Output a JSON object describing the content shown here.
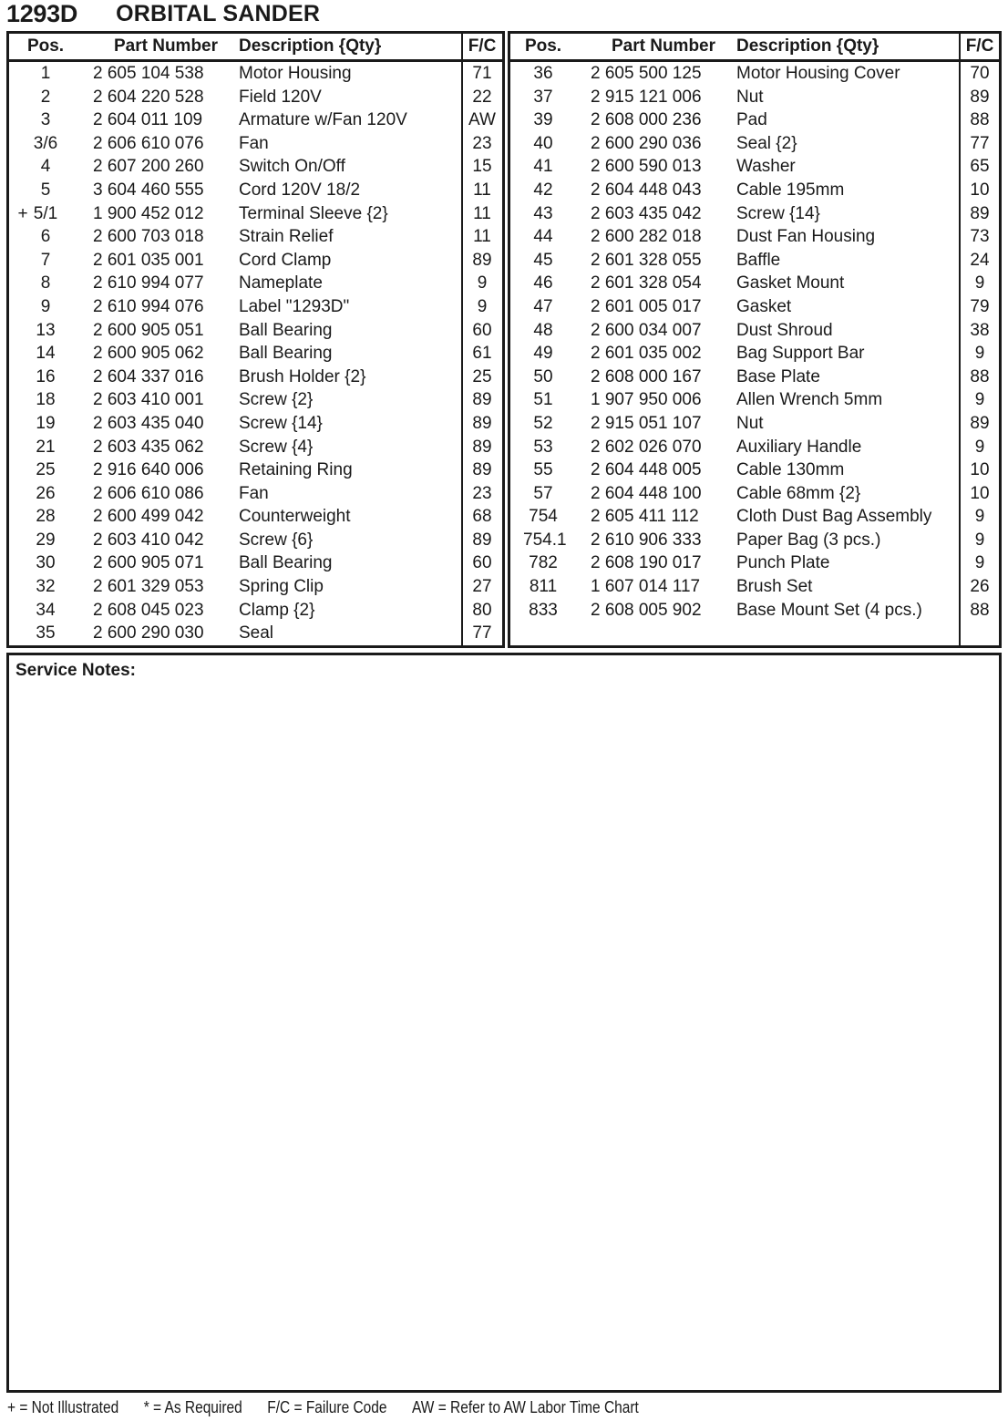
{
  "title": {
    "model": "1293D",
    "product": "ORBITAL  SANDER"
  },
  "columns": {
    "pos": "Pos.",
    "part_number": "Part Number",
    "description": "Description {Qty}",
    "fc": "F/C"
  },
  "left_table": {
    "rows": [
      {
        "flag": "",
        "pos": "1",
        "part_number": "2 605 104 538",
        "description": "Motor Housing",
        "fc": "71"
      },
      {
        "flag": "",
        "pos": "2",
        "part_number": "2 604 220 528",
        "description": "Field 120V",
        "fc": "22"
      },
      {
        "flag": "",
        "pos": "3",
        "part_number": "2 604 011 109",
        "description": "Armature w/Fan 120V",
        "fc": "AW"
      },
      {
        "flag": "",
        "pos": "3/6",
        "part_number": "2 606 610 076",
        "description": "Fan",
        "fc": "23"
      },
      {
        "flag": "",
        "pos": "4",
        "part_number": "2 607 200 260",
        "description": "Switch On/Off",
        "fc": "15"
      },
      {
        "flag": "",
        "pos": "5",
        "part_number": "3 604 460 555",
        "description": "Cord 120V 18/2",
        "fc": "11"
      },
      {
        "flag": "+",
        "pos": "5/1",
        "part_number": "1 900 452 012",
        "description": "Terminal Sleeve {2}",
        "fc": "11"
      },
      {
        "flag": "",
        "pos": "6",
        "part_number": "2 600 703 018",
        "description": "Strain Relief",
        "fc": "11"
      },
      {
        "flag": "",
        "pos": "7",
        "part_number": "2 601 035 001",
        "description": "Cord Clamp",
        "fc": "89"
      },
      {
        "flag": "",
        "pos": "8",
        "part_number": "2 610 994 077",
        "description": "Nameplate",
        "fc": "9"
      },
      {
        "flag": "",
        "pos": "9",
        "part_number": "2 610 994 076",
        "description": "Label \"1293D\"",
        "fc": "9"
      },
      {
        "flag": "",
        "pos": "13",
        "part_number": "2 600 905 051",
        "description": "Ball Bearing",
        "fc": "60"
      },
      {
        "flag": "",
        "pos": "14",
        "part_number": "2 600 905 062",
        "description": "Ball Bearing",
        "fc": "61"
      },
      {
        "flag": "",
        "pos": "16",
        "part_number": "2 604 337 016",
        "description": "Brush Holder {2}",
        "fc": "25"
      },
      {
        "flag": "",
        "pos": "18",
        "part_number": "2 603 410 001",
        "description": "Screw {2}",
        "fc": "89"
      },
      {
        "flag": "",
        "pos": "19",
        "part_number": "2 603 435 040",
        "description": "Screw {14}",
        "fc": "89"
      },
      {
        "flag": "",
        "pos": "21",
        "part_number": "2 603 435 062",
        "description": "Screw {4}",
        "fc": "89"
      },
      {
        "flag": "",
        "pos": "25",
        "part_number": "2 916 640 006",
        "description": "Retaining Ring",
        "fc": "89"
      },
      {
        "flag": "",
        "pos": "26",
        "part_number": "2 606 610 086",
        "description": "Fan",
        "fc": "23"
      },
      {
        "flag": "",
        "pos": "28",
        "part_number": "2 600 499 042",
        "description": "Counterweight",
        "fc": "68"
      },
      {
        "flag": "",
        "pos": "29",
        "part_number": "2 603 410 042",
        "description": "Screw {6}",
        "fc": "89"
      },
      {
        "flag": "",
        "pos": "30",
        "part_number": "2 600 905 071",
        "description": "Ball Bearing",
        "fc": "60"
      },
      {
        "flag": "",
        "pos": "32",
        "part_number": "2 601 329 053",
        "description": "Spring Clip",
        "fc": "27"
      },
      {
        "flag": "",
        "pos": "34",
        "part_number": "2 608 045 023",
        "description": "Clamp {2}",
        "fc": "80"
      },
      {
        "flag": "",
        "pos": "35",
        "part_number": "2 600 290 030",
        "description": "Seal",
        "fc": "77"
      }
    ]
  },
  "right_table": {
    "rows": [
      {
        "flag": "",
        "pos": "36",
        "part_number": "2 605 500 125",
        "description": "Motor Housing Cover",
        "fc": "70"
      },
      {
        "flag": "",
        "pos": "37",
        "part_number": "2 915 121 006",
        "description": "Nut",
        "fc": "89"
      },
      {
        "flag": "",
        "pos": "39",
        "part_number": "2 608 000 236",
        "description": "Pad",
        "fc": "88"
      },
      {
        "flag": "",
        "pos": "40",
        "part_number": "2 600 290 036",
        "description": "Seal {2}",
        "fc": "77"
      },
      {
        "flag": "",
        "pos": "41",
        "part_number": "2 600 590 013",
        "description": "Washer",
        "fc": "65"
      },
      {
        "flag": "",
        "pos": "42",
        "part_number": "2 604 448 043",
        "description": "Cable 195mm",
        "fc": "10"
      },
      {
        "flag": "",
        "pos": "43",
        "part_number": "2 603 435 042",
        "description": "Screw {14}",
        "fc": "89"
      },
      {
        "flag": "",
        "pos": "44",
        "part_number": "2 600 282 018",
        "description": "Dust Fan Housing",
        "fc": "73"
      },
      {
        "flag": "",
        "pos": "45",
        "part_number": "2 601 328 055",
        "description": "Baffle",
        "fc": "24"
      },
      {
        "flag": "",
        "pos": "46",
        "part_number": "2 601 328 054",
        "description": "Gasket Mount",
        "fc": "9"
      },
      {
        "flag": "",
        "pos": "47",
        "part_number": "2 601 005 017",
        "description": "Gasket",
        "fc": "79"
      },
      {
        "flag": "",
        "pos": "48",
        "part_number": "2 600 034 007",
        "description": "Dust Shroud",
        "fc": "38"
      },
      {
        "flag": "",
        "pos": "49",
        "part_number": "2 601 035 002",
        "description": "Bag Support Bar",
        "fc": "9"
      },
      {
        "flag": "",
        "pos": "50",
        "part_number": "2 608 000 167",
        "description": "Base Plate",
        "fc": "88"
      },
      {
        "flag": "",
        "pos": "51",
        "part_number": "1 907 950 006",
        "description": "Allen Wrench 5mm",
        "fc": "9"
      },
      {
        "flag": "",
        "pos": "52",
        "part_number": "2 915 051 107",
        "description": "Nut",
        "fc": "89"
      },
      {
        "flag": "",
        "pos": "53",
        "part_number": "2 602 026 070",
        "description": "Auxiliary Handle",
        "fc": "9"
      },
      {
        "flag": "",
        "pos": "55",
        "part_number": "2 604 448 005",
        "description": "Cable 130mm",
        "fc": "10"
      },
      {
        "flag": "",
        "pos": "57",
        "part_number": "2 604 448 100",
        "description": "Cable 68mm {2}",
        "fc": "10"
      },
      {
        "flag": "",
        "pos": "754",
        "part_number": "2 605 411 112",
        "description": "Cloth Dust Bag Assembly",
        "fc": "9"
      },
      {
        "flag": "",
        "pos": "754.1",
        "part_number": "2 610 906 333",
        "description": "Paper Bag (3 pcs.)",
        "fc": "9"
      },
      {
        "flag": "",
        "pos": "782",
        "part_number": "2 608 190 017",
        "description": "Punch Plate",
        "fc": "9"
      },
      {
        "flag": "",
        "pos": "811",
        "part_number": "1 607 014 117",
        "description": "Brush Set",
        "fc": "26"
      },
      {
        "flag": "",
        "pos": "833",
        "part_number": "2 608 005 902",
        "description": "Base Mount Set (4 pcs.)",
        "fc": "88"
      }
    ]
  },
  "service_notes": {
    "label": "Service Notes:",
    "content": ""
  },
  "footer": {
    "not_illustrated": "+ = Not Illustrated",
    "as_required": "* = As Required",
    "failure_code": "F/C = Failure Code",
    "aw": "AW = Refer to AW Labor Time Chart"
  },
  "colors": {
    "ink": "#1a1a1a",
    "paper": "#ffffff"
  }
}
